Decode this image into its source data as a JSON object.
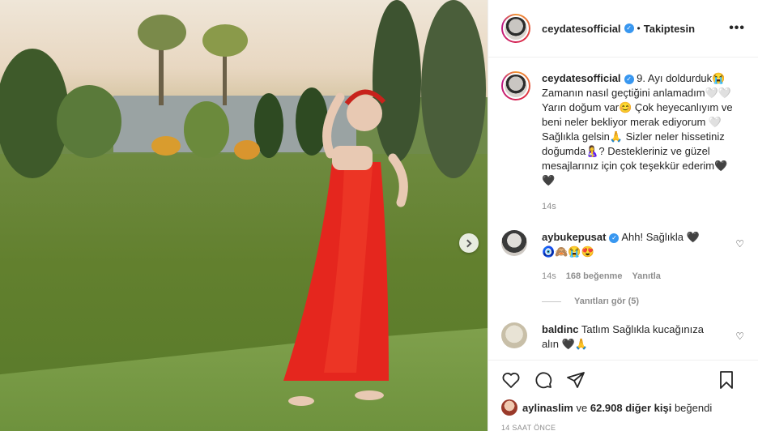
{
  "post": {
    "username": "ceydatesofficial",
    "follow_state": "Takiptesin",
    "caption": "9. Ayı doldurduk😭 Zamanın nasıl geçtiğini anlamadım🤍🤍 Yarın doğum var😊 Çok heyecanlıyım ve beni neler bekliyor merak ediyorum 🤍Sağlıkla gelsin🙏 Sizler neler hissetiniz doğumda🤱? Destekleriniz ve güzel mesajlarınız için çok teşekkür ederim🖤🖤",
    "caption_time": "14s"
  },
  "comments": [
    {
      "username": "aybukepusat",
      "text": "Ahh! Sağlıkla 🖤",
      "text2": "🧿🙈😭😍",
      "time": "14s",
      "likes": "168 beğenme",
      "reply": "Yanıtla",
      "view_replies": "Yanıtları gör (5)"
    },
    {
      "username": "baldinc",
      "text": "Tatlım Sağlıkla kucağınıza alın 🖤🙏"
    }
  ],
  "likes": {
    "first_user": "aylinaslim",
    "and": "ve",
    "count": "62.908 diğer kişi",
    "suffix": "beğendi"
  },
  "timestamp": "14 SAAT ÖNCE",
  "colors": {
    "verified": "#3897f0",
    "muted": "#8e8e8e",
    "text": "#262626"
  }
}
